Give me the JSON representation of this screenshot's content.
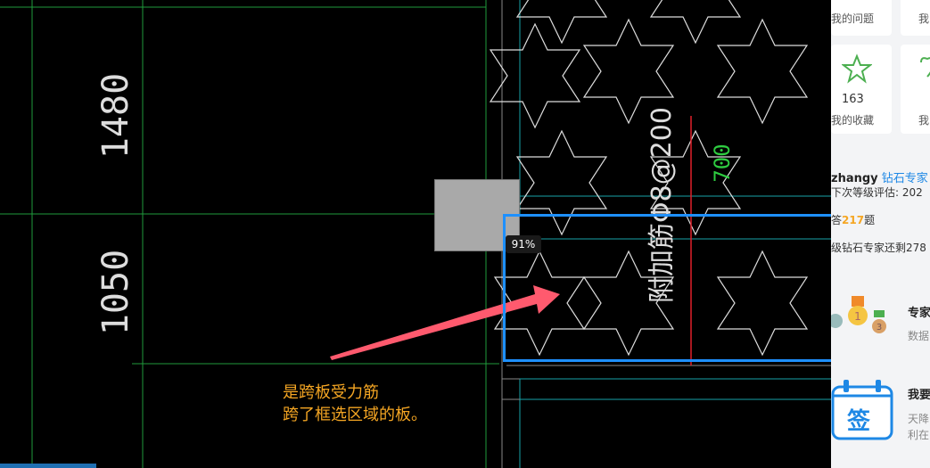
{
  "canvas": {
    "dim_1480": "1480",
    "dim_1050": "1050",
    "rebar_label": "附加筋Φ8@200",
    "green_label": "700",
    "zoom_label": "91%"
  },
  "annotation": {
    "line1": "是跨板受力筋",
    "line2": "跨了框选区域的板。"
  },
  "sidebar": {
    "my_questions": "我的问题",
    "my_questions_cut": "我",
    "favorites_count": "163",
    "favorites_label": "我的收藏",
    "favorites_cut": "我",
    "user_name": "zhangy",
    "user_badge": "钻石专家",
    "next_level": "下次等级评估: 202",
    "answers_prefix": "答",
    "answers_count": "217",
    "answers_suffix": "题",
    "remaining": "级钻石专家还剩278",
    "expert_title": "专家",
    "expert_sub": "数据",
    "sign_label": "签",
    "want_sign": "我要",
    "sign_sub1": "天降",
    "sign_sub2": "利在",
    "colors": {
      "accent": "#1e90ff",
      "badge": "#1f6fb2",
      "orange": "#f5a623"
    }
  }
}
